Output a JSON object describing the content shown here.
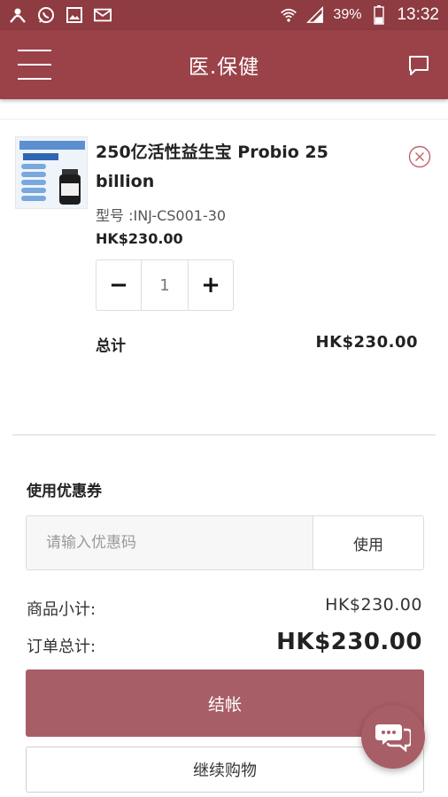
{
  "status_bar": {
    "icons": [
      "person-x-icon",
      "whatsapp-icon",
      "gallery-icon",
      "mail-icon"
    ],
    "wifi_icon": "wifi-icon",
    "signal_icon": "signal-icon",
    "battery_percent": "39%",
    "battery_level": 0.39,
    "time": "13:32"
  },
  "app_bar": {
    "title": "医.保健",
    "menu_icon": "hamburger-menu-icon",
    "chat_icon": "chat-bubble-icon",
    "color": "#9b4249"
  },
  "cart": {
    "item": {
      "name": "250亿活性益生宝 Probio 25 billion",
      "model": "型号 :INJ-CS001-30",
      "price": "HK$230.00",
      "quantity": "1",
      "minus_label": "−",
      "plus_label": "+",
      "total_label": "总计",
      "total_value": "HK$230.00"
    }
  },
  "coupon": {
    "title": "使用优惠券",
    "placeholder": "请输入优惠码",
    "apply_label": "使用"
  },
  "summary": {
    "subtotal_label": "商品小计:",
    "subtotal_value": "HK$230.00",
    "total_label": "订单总计:",
    "total_value": "HK$230.00"
  },
  "actions": {
    "checkout_label": "结帐",
    "continue_label": "继续购物",
    "checkout_color": "#a85e66"
  }
}
